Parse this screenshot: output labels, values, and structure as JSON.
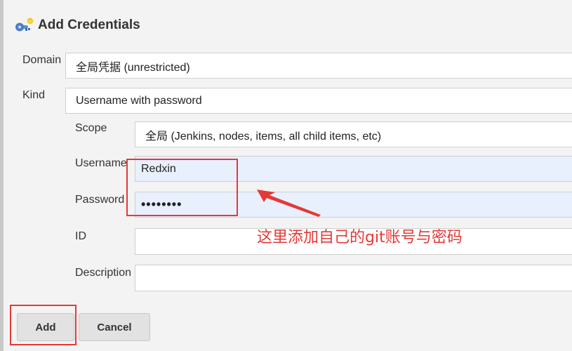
{
  "title": "Add Credentials",
  "domain": {
    "label": "Domain",
    "value": "全局凭据 (unrestricted)"
  },
  "kind": {
    "label": "Kind",
    "value": "Username with password"
  },
  "scope": {
    "label": "Scope",
    "value": "全局 (Jenkins, nodes, items, all child items, etc)"
  },
  "username": {
    "label": "Username",
    "value": "Redxin"
  },
  "password": {
    "label": "Password",
    "value": "••••••••"
  },
  "id": {
    "label": "ID",
    "value": ""
  },
  "description": {
    "label": "Description",
    "value": ""
  },
  "buttons": {
    "add": "Add",
    "cancel": "Cancel"
  },
  "annotation": {
    "text": "这里添加自己的git账号与密码",
    "color": "#e53935"
  },
  "colors": {
    "autofill_bg": "#e8f0fe",
    "page_bg": "#f3f3f3"
  },
  "icons": {
    "title_icon": "credentials-key-icon"
  }
}
